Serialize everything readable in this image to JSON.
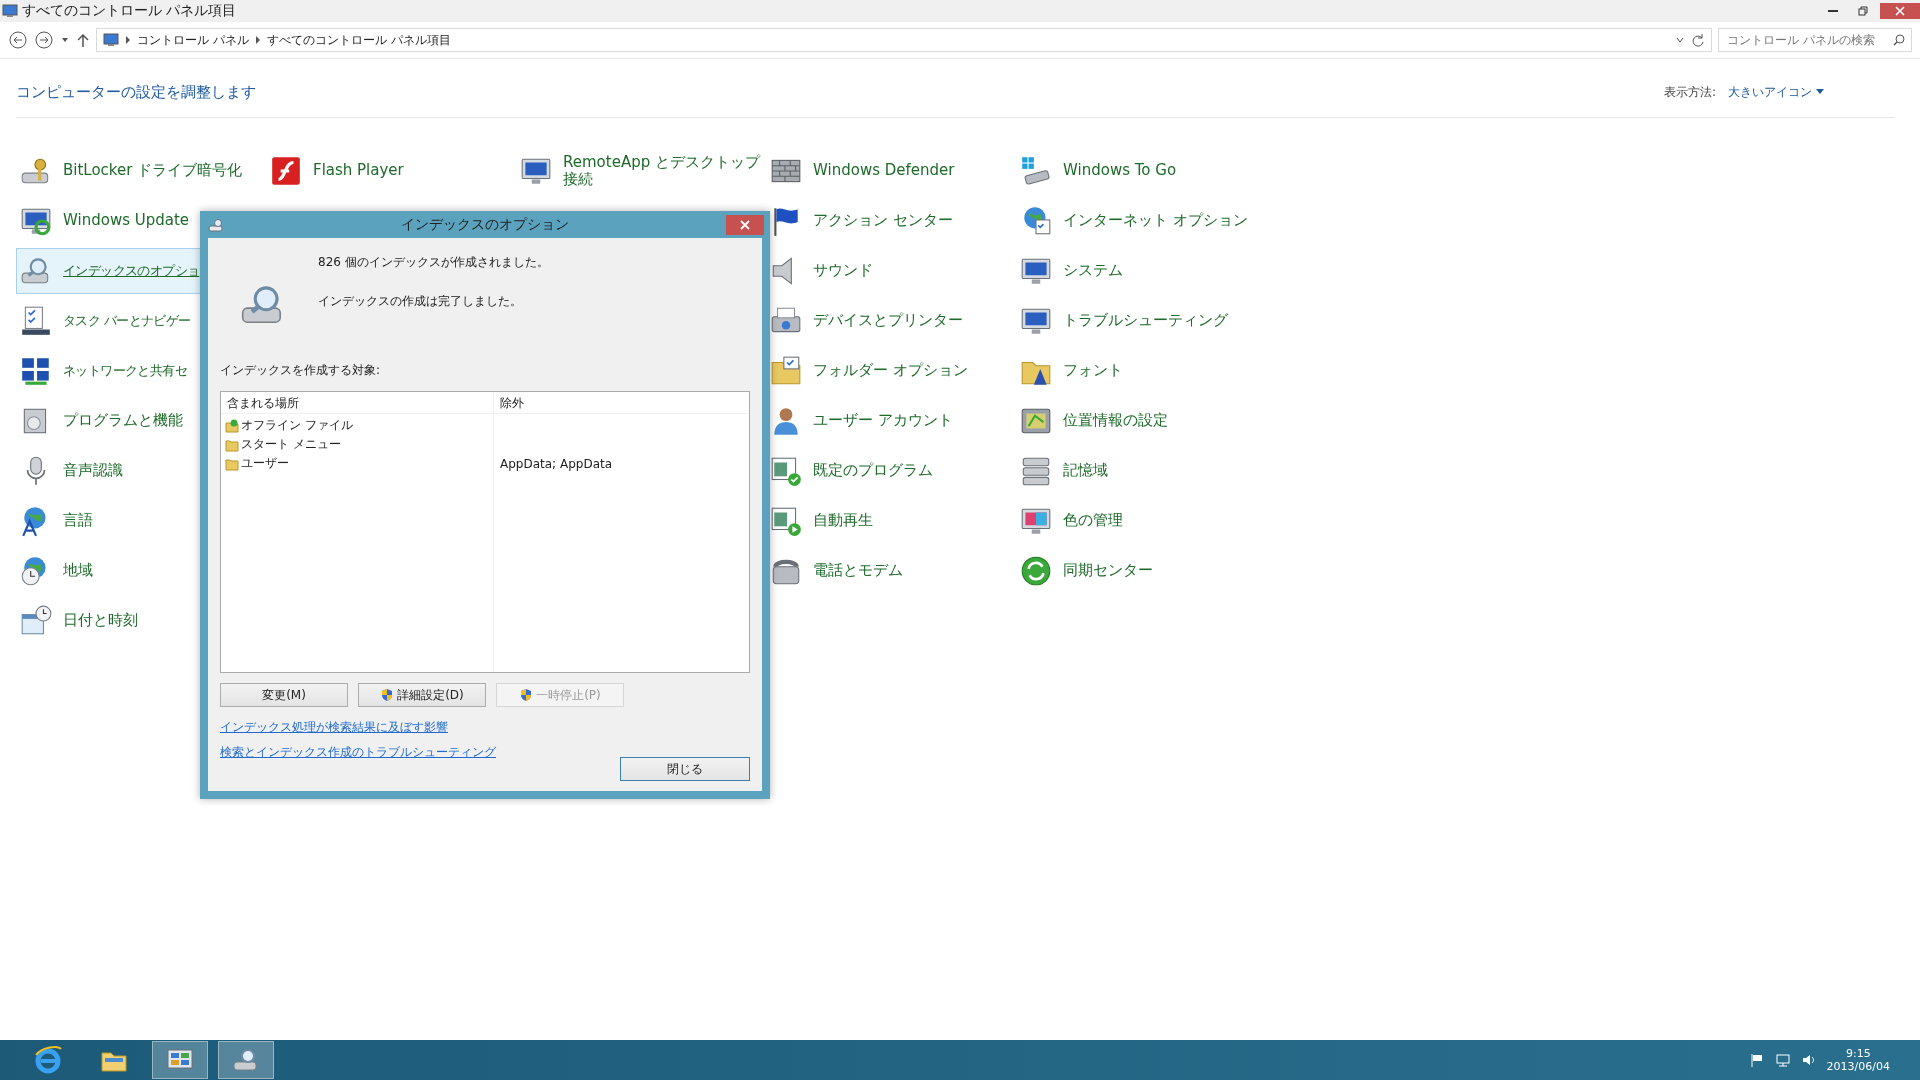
{
  "window": {
    "title": "すべてのコントロール パネル項目"
  },
  "address_bar": {
    "breadcrumb": [
      "コントロール パネル",
      "すべてのコントロール パネル項目"
    ],
    "search": {
      "placeholder": "コントロール パネルの検索"
    }
  },
  "header": {
    "title": "コンピューターの設定を調整します",
    "view_label": "表示方法:",
    "view_value": "大きいアイコン"
  },
  "columns": [
    [
      {
        "label": "BitLocker ドライブ暗号化",
        "selected": false
      },
      {
        "label": "Windows Update",
        "selected": false
      },
      {
        "label": "インデックスのオプショ",
        "selected": true
      },
      {
        "label": "タスク バーとナビゲー",
        "selected": false
      },
      {
        "label": "ネットワークと共有セ",
        "selected": false
      },
      {
        "label": "プログラムと機能",
        "selected": false
      },
      {
        "label": "音声認識",
        "selected": false
      },
      {
        "label": "言語",
        "selected": false
      },
      {
        "label": "地域",
        "selected": false
      },
      {
        "label": "日付と時刻",
        "selected": false
      }
    ],
    [
      {
        "label": "Flash Player",
        "selected": false
      }
    ],
    [
      {
        "label": "RemoteApp とデスクトップ接続",
        "selected": false
      }
    ],
    [
      {
        "label": "Windows Defender",
        "selected": false
      },
      {
        "label": "アクション センター",
        "selected": false
      },
      {
        "label": "サウンド",
        "selected": false
      },
      {
        "label": "デバイスとプリンター",
        "selected": false
      },
      {
        "label": "フォルダー オプション",
        "selected": false
      },
      {
        "label": "ユーザー アカウント",
        "selected": false
      },
      {
        "label": "既定のプログラム",
        "selected": false
      },
      {
        "label": "自動再生",
        "selected": false
      },
      {
        "label": "電話とモデム",
        "selected": false
      }
    ],
    [
      {
        "label": "Windows To Go",
        "selected": false
      },
      {
        "label": "インターネット オプション",
        "selected": false
      },
      {
        "label": "システム",
        "selected": false
      },
      {
        "label": "トラブルシューティング",
        "selected": false
      },
      {
        "label": "フォント",
        "selected": false
      },
      {
        "label": "位置情報の設定",
        "selected": false
      },
      {
        "label": "記憶域",
        "selected": false
      },
      {
        "label": "色の管理",
        "selected": false
      },
      {
        "label": "同期センター",
        "selected": false
      }
    ]
  ],
  "dialog": {
    "title": "インデックスのオプション",
    "status_lines": [
      "826 個のインデックスが作成されました。",
      "インデックスの作成は完了しました。"
    ],
    "list_label": "インデックスを作成する対象:",
    "list": {
      "columns": [
        "含まれる場所",
        "除外"
      ],
      "rows": [
        {
          "location": "オフライン ファイル",
          "kind": "sync-folder"
        },
        {
          "location": "スタート メニュー",
          "kind": "folder"
        },
        {
          "location": "ユーザー",
          "kind": "folder",
          "exclude": "AppData; AppData"
        }
      ]
    },
    "buttons": [
      {
        "label": "変更(M)",
        "shield": false,
        "disabled": false
      },
      {
        "label": "詳細設定(D)",
        "shield": true,
        "disabled": false
      },
      {
        "label": "一時停止(P)",
        "shield": true,
        "disabled": true
      }
    ],
    "links": [
      "インデックス処理が検索結果に及ぼす影響",
      "検索とインデックス作成のトラブルシューティング"
    ],
    "close_button": "閉じる"
  },
  "taskbar": {
    "apps": [
      {
        "selected": false
      },
      {
        "selected": false
      },
      {
        "selected": true
      },
      {
        "selected": true
      }
    ],
    "clock": {
      "time": "9:15",
      "date": "2013/06/04"
    }
  }
}
